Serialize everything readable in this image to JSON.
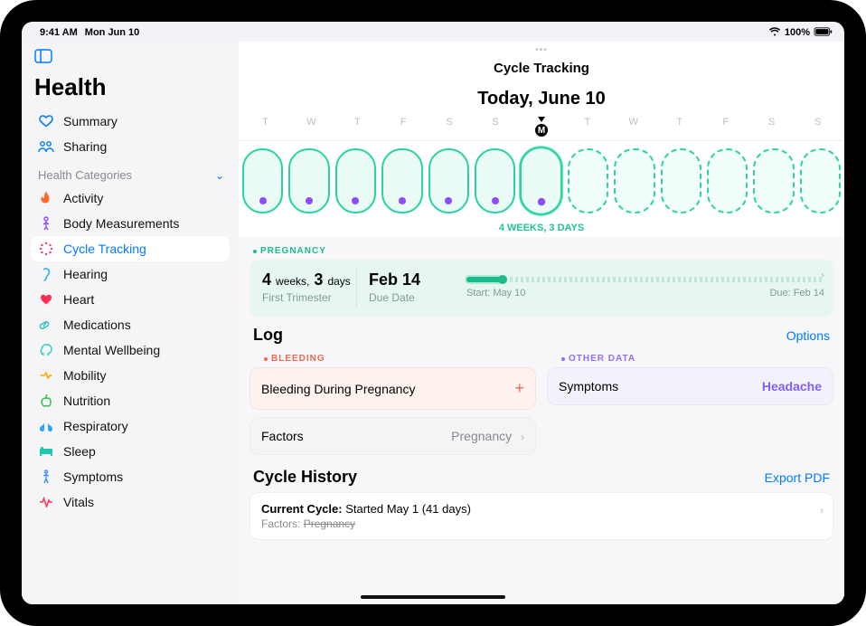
{
  "status": {
    "time": "9:41 AM",
    "date": "Mon Jun 10",
    "battery": "100%"
  },
  "app_title": "Health",
  "nav": {
    "summary": "Summary",
    "sharing": "Sharing",
    "categories_header": "Health Categories",
    "items": [
      "Activity",
      "Body Measurements",
      "Cycle Tracking",
      "Hearing",
      "Heart",
      "Medications",
      "Mental Wellbeing",
      "Mobility",
      "Nutrition",
      "Respiratory",
      "Sleep",
      "Symptoms",
      "Vitals"
    ]
  },
  "page": {
    "title": "Cycle Tracking",
    "today": "Today, June 10",
    "dow": [
      "T",
      "W",
      "T",
      "F",
      "S",
      "S",
      "M",
      "T",
      "W",
      "T",
      "F",
      "S",
      "S"
    ],
    "today_index": 6,
    "past_with_dot_count": 7,
    "duration": "4 WEEKS, 3 DAYS"
  },
  "pregnancy": {
    "label": "PREGNANCY",
    "weeks": "4",
    "weeks_word": "weeks,",
    "days": "3",
    "days_word": "days",
    "sub": "First Trimester",
    "due_big": "Feb 14",
    "due_sub": "Due Date",
    "start": "Start: May 10",
    "due": "Due: Feb 14",
    "progress": 10
  },
  "log": {
    "title": "Log",
    "options": "Options",
    "bleeding_label": "BLEEDING",
    "bleeding_row": "Bleeding During Pregnancy",
    "factors_label": "Factors",
    "factors_value": "Pregnancy",
    "other_label": "OTHER DATA",
    "symptoms_label": "Symptoms",
    "symptoms_value": "Headache"
  },
  "history": {
    "title": "Cycle History",
    "export": "Export PDF",
    "prefix": "Current Cycle:",
    "line1": " Started May 1 (41 days)",
    "line2_label": "Factors:",
    "line2_value": "Pregnancy"
  }
}
